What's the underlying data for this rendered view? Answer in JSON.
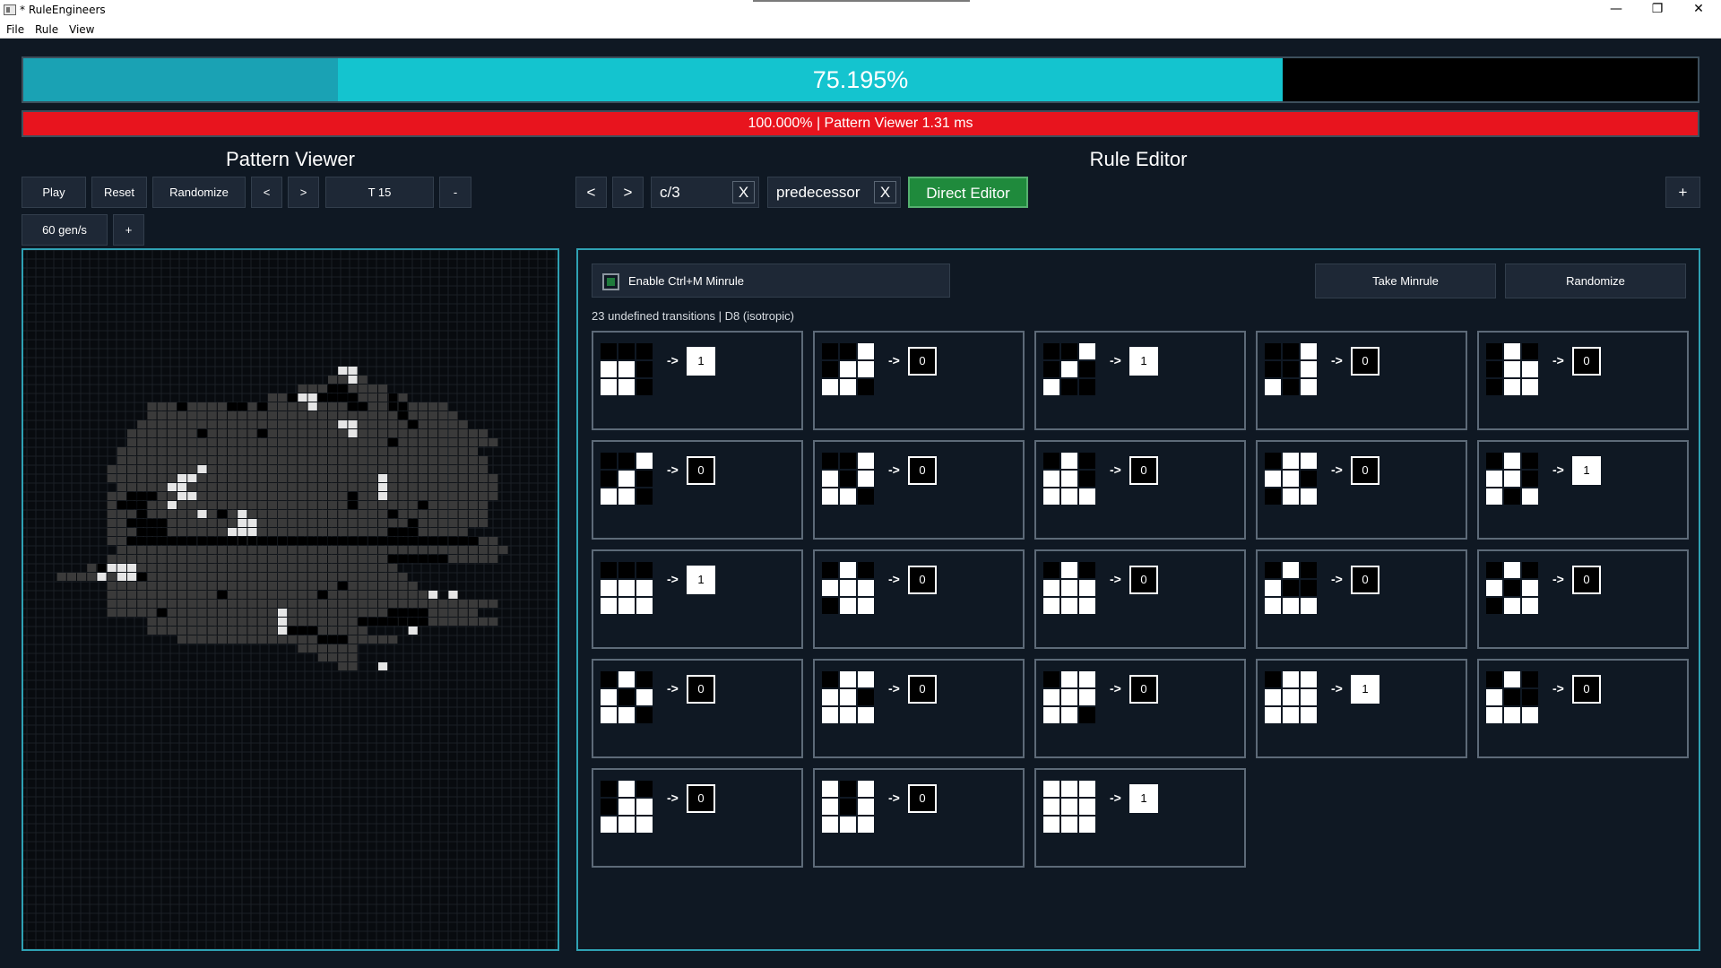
{
  "window": {
    "title": "* RuleEngineers",
    "minimize": "—",
    "maximize": "❐",
    "close": "✕"
  },
  "menu": [
    "File",
    "Rule",
    "View"
  ],
  "progress": {
    "fraction_dark": 0.188,
    "fraction": 0.75195,
    "label": "75.195%",
    "dark_color": "#1aa2b4",
    "fill_color": "#14c4cf",
    "empty_color": "#000000"
  },
  "status": {
    "text": "100.000% | Pattern Viewer 1.31 ms",
    "color": "#e8141e"
  },
  "pattern_viewer": {
    "title": "Pattern Viewer",
    "buttons": {
      "play": "Play",
      "reset": "Reset",
      "randomize": "Randomize",
      "prev": "<",
      "next": ">",
      "time": "T 15",
      "minus": "-",
      "speed": "60 gen/s",
      "plus": "+"
    }
  },
  "rule_editor": {
    "title": "Rule Editor",
    "nav_prev": "<",
    "nav_next": ">",
    "tags": [
      {
        "label": "c/3",
        "close": "X"
      },
      {
        "label": "predecessor",
        "close": "X"
      }
    ],
    "direct_editor": "Direct Editor",
    "add": "+",
    "minrule_label": "Enable Ctrl+M Minrule",
    "take_minrule": "Take Minrule",
    "randomize": "Randomize",
    "info": "23 undefined transitions  |  D8 (isotropic)",
    "arrow": "->",
    "transitions": [
      {
        "cells": "000110110",
        "out": "1"
      },
      {
        "cells": "001011110",
        "out": "0"
      },
      {
        "cells": "001010100",
        "out": "1"
      },
      {
        "cells": "001001101",
        "out": "0"
      },
      {
        "cells": "010011011",
        "out": "0"
      },
      {
        "cells": "001010110",
        "out": "0"
      },
      {
        "cells": "001101110",
        "out": "0"
      },
      {
        "cells": "010110111",
        "out": "0"
      },
      {
        "cells": "011110011",
        "out": "0"
      },
      {
        "cells": "010110101",
        "out": "1"
      },
      {
        "cells": "000111111",
        "out": "1"
      },
      {
        "cells": "010111011",
        "out": "0"
      },
      {
        "cells": "010111111",
        "out": "0"
      },
      {
        "cells": "010100111",
        "out": "0"
      },
      {
        "cells": "010101011",
        "out": "0"
      },
      {
        "cells": "010101110",
        "out": "0"
      },
      {
        "cells": "011110111",
        "out": "0"
      },
      {
        "cells": "011111110",
        "out": "0"
      },
      {
        "cells": "011111111",
        "out": "1"
      },
      {
        "cells": "010100111",
        "out": "0"
      },
      {
        "cells": "010011111",
        "out": "0"
      },
      {
        "cells": "101101111",
        "out": "0"
      },
      {
        "cells": "111111111",
        "out": "1"
      }
    ]
  },
  "pattern": {
    "cell_bright": "#e6e6e6",
    "cell_mid": "#3a3a3a",
    "cell_dark": "#000000",
    "grid_line": "#1a1f25",
    "rows": [
      "...............................................",
      "...............................................",
      "...............................................",
      "...............................................",
      "...............................................",
      "...............................................",
      "...............................................",
      "...............................................",
      "...............................##..............",
      "..............................####.............",
      "...........................###..####...........",
      "........................##.##....###.#.........",
      "............###.####..#.########..##..####.....",
      "............#########################.#####....",
      "...........###########################.#####...",
      "..........#######.#####.######################.",
      "..........##########################.##########",
      ".........####################################..",
      ".........#####################################.",
      "........######################################.",
      "........#######################################",
      ".........######################################",
      "........##...###################.##############",
      "........#...####################.######.######.",
      "........###.#######.################.#########.",
      "........##....########################.#######.",
      "........###...######################...#####...",
      "........##...................................##",
      ".........#######################################",
      "........############################......#####",
      "......#.#############################...........",
      "...########.##########################.........",
      "........#######################.#######........",
      "........###########.#########.###########......",
      "........#######################################",
      "........#####.######################....#####..",
      "............#####################.......#######",
      "............##############...#####.............",
      "...............##############...#####...........",
      "...........................######...............",
      ".............................####...............",
      "...............................##..............."
    ],
    "bright_cells": [
      [
        8,
        31
      ],
      [
        8,
        32
      ],
      [
        9,
        32
      ],
      [
        11,
        27
      ],
      [
        11,
        28
      ],
      [
        12,
        28
      ],
      [
        11,
        36
      ],
      [
        12,
        37
      ],
      [
        12,
        36
      ],
      [
        14,
        31
      ],
      [
        15,
        32
      ],
      [
        14,
        32
      ],
      [
        20,
        15
      ],
      [
        20,
        16
      ],
      [
        21,
        14
      ],
      [
        21,
        15
      ],
      [
        22,
        15
      ],
      [
        22,
        16
      ],
      [
        23,
        14
      ],
      [
        24,
        17
      ],
      [
        19,
        17
      ],
      [
        20,
        35
      ],
      [
        21,
        35
      ],
      [
        22,
        35
      ],
      [
        25,
        21
      ],
      [
        24,
        21
      ],
      [
        25,
        22
      ],
      [
        26,
        20
      ],
      [
        26,
        21
      ],
      [
        26,
        22
      ],
      [
        27,
        21
      ],
      [
        27,
        22
      ],
      [
        30,
        7
      ],
      [
        30,
        8
      ],
      [
        30,
        9
      ],
      [
        30,
        10
      ],
      [
        31,
        7
      ],
      [
        31,
        9
      ],
      [
        31,
        10
      ],
      [
        33,
        40
      ],
      [
        33,
        42
      ],
      [
        35,
        25
      ],
      [
        36,
        25
      ],
      [
        37,
        25
      ],
      [
        36,
        37
      ],
      [
        37,
        38
      ],
      [
        41,
        35
      ],
      [
        42,
        36
      ]
    ]
  }
}
